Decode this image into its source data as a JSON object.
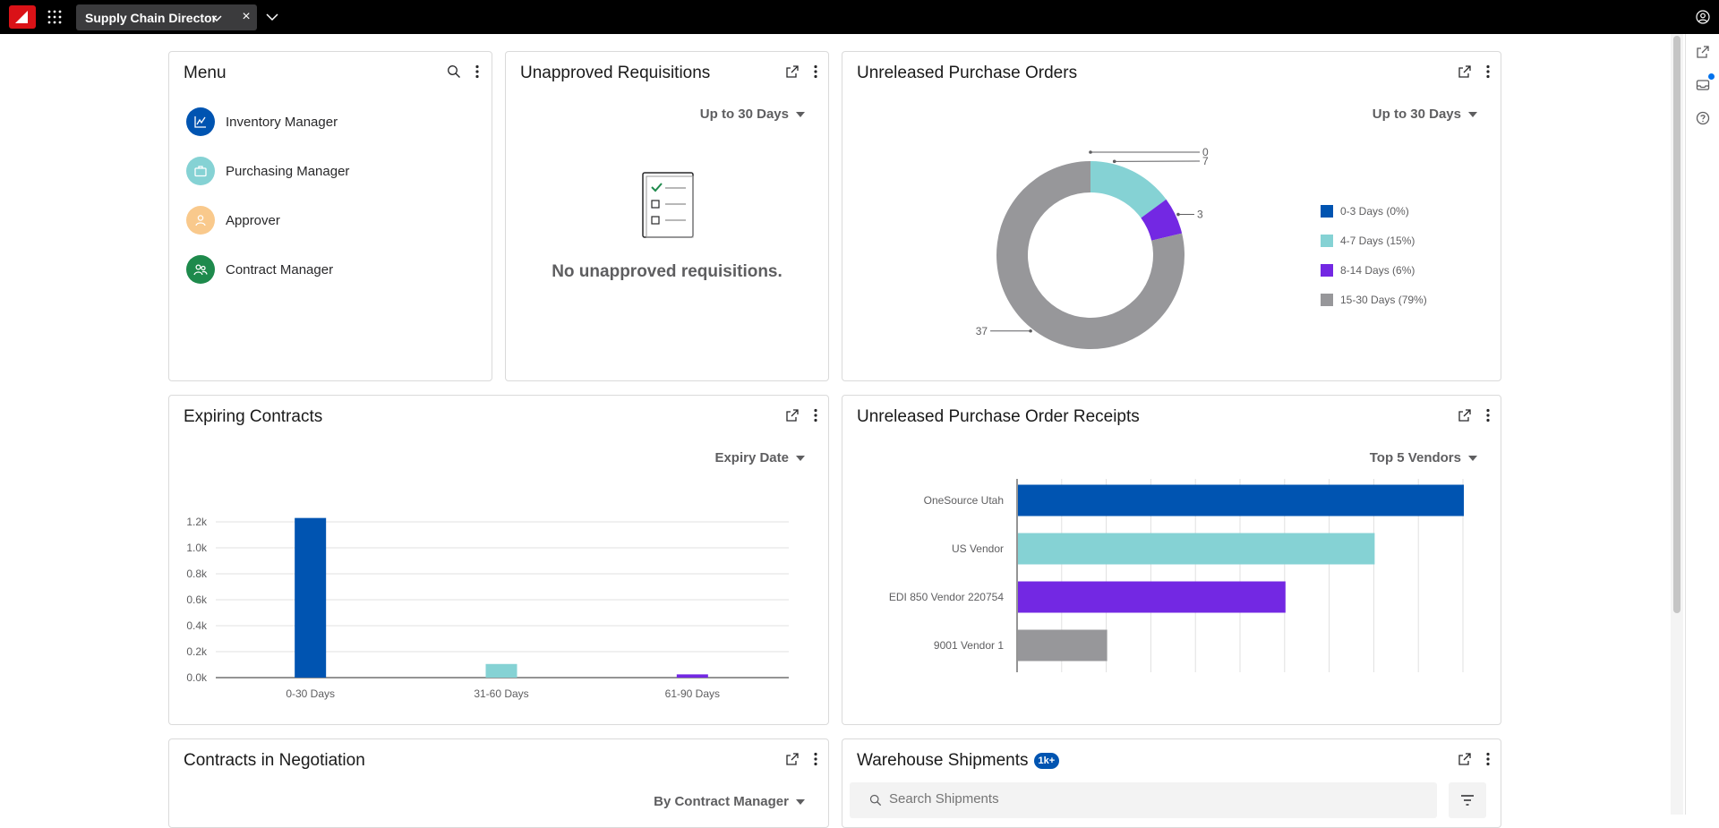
{
  "app": {
    "workspace_tab": "Supply Chain Director",
    "close_symbol": "×"
  },
  "icons": {
    "logo": "brand-logo",
    "apps": "grid-icon",
    "user": "user-icon",
    "rail": [
      "popout-icon",
      "inbox-icon",
      "help-icon"
    ]
  },
  "menu_card": {
    "title": "Menu",
    "items": [
      {
        "label": "Inventory Manager",
        "color": "#0054b1",
        "icon": "chart-icon"
      },
      {
        "label": "Purchasing Manager",
        "color": "#85d2d4",
        "icon": "briefcase-icon"
      },
      {
        "label": "Approver",
        "color": "#f9c98c",
        "icon": "person-icon"
      },
      {
        "label": "Contract Manager",
        "color": "#1e8a4c",
        "icon": "people-icon"
      }
    ]
  },
  "requisitions_card": {
    "title": "Unapproved Requisitions",
    "filter": "Up to 30 Days",
    "empty_message": "No unapproved requisitions."
  },
  "purchase_orders_card": {
    "title": "Unreleased Purchase Orders",
    "filter": "Up to 30 Days"
  },
  "expiring_card": {
    "title": "Expiring Contracts",
    "filter": "Expiry Date"
  },
  "receipts_card": {
    "title": "Unreleased Purchase Order Receipts",
    "filter": "Top 5 Vendors"
  },
  "negotiation_card": {
    "title": "Contracts in Negotiation",
    "filter": "By Contract Manager"
  },
  "shipments_card": {
    "title": "Warehouse Shipments",
    "badge": "1k+",
    "search_placeholder": "Search Shipments"
  },
  "chart_data": [
    {
      "type": "pie",
      "donut": true,
      "categories": [
        "0-3 Days",
        "4-7 Days",
        "8-14 Days",
        "15-30 Days"
      ],
      "values": [
        0,
        7,
        3,
        37
      ],
      "data_labels": [
        "0",
        "7",
        "3",
        "37"
      ],
      "legend": [
        "0-3 Days (0%)",
        "4-7 Days (15%)",
        "8-14 Days (6%)",
        "15-30 Days (79%)"
      ],
      "legend_position": "right",
      "colors": [
        "#0054b1",
        "#85d2d4",
        "#7328e3",
        "#97979a"
      ]
    },
    {
      "type": "bar",
      "categories": [
        "0-30 Days",
        "31-60 Days",
        "61-90 Days"
      ],
      "values": [
        1230,
        105,
        25
      ],
      "colors": [
        "#0054b1",
        "#85d2d4",
        "#7328e3"
      ],
      "ylim": [
        0,
        1200
      ],
      "yticks": [
        0,
        200,
        400,
        600,
        800,
        1000,
        1200
      ],
      "yticklabels": [
        "0.0k",
        "0.2k",
        "0.4k",
        "0.6k",
        "0.8k",
        "1.0k",
        "1.2k"
      ],
      "grid": true
    },
    {
      "type": "bar",
      "orientation": "horizontal",
      "categories": [
        "OneSource Utah",
        "US Vendor",
        "EDI 850 Vendor 220754",
        "9001 Vendor 1"
      ],
      "values": [
        10,
        8,
        6,
        2
      ],
      "xlim": [
        0,
        10
      ],
      "colors": [
        "#0054b1",
        "#85d2d4",
        "#7328e3",
        "#97979a"
      ],
      "grid": true
    }
  ]
}
